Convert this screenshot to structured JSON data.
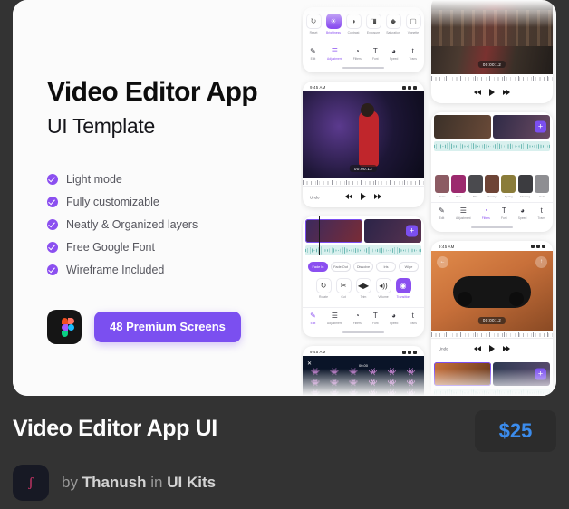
{
  "card": {
    "promo": {
      "title": "Video Editor App",
      "subtitle": "UI Template",
      "features": [
        {
          "label": "Light mode",
          "icon": "check-circle-icon"
        },
        {
          "label": "Fully customizable",
          "icon": "check-circle-icon"
        },
        {
          "label": "Neatly & Organized layers",
          "icon": "check-circle-icon"
        },
        {
          "label": "Free Google Font",
          "icon": "check-circle-icon"
        },
        {
          "label": "Wireframe Included",
          "icon": "check-circle-icon"
        }
      ],
      "figma_icon": "figma-logo-icon",
      "cta_label": "48 Premium Screens",
      "accent_color": "#7b4ff0"
    },
    "gallery": {
      "status_time": "9:45 AM",
      "phones": [
        {
          "id": "editor-adjustment",
          "timecode": "",
          "chips": [],
          "tools": [
            {
              "label": "Reset",
              "glyph": "↻",
              "active": false
            },
            {
              "label": "Brightness",
              "glyph": "☀",
              "active": true
            },
            {
              "label": "Contrast",
              "glyph": "◑",
              "active": false
            },
            {
              "label": "Exposure",
              "glyph": "◨",
              "active": false
            },
            {
              "label": "Saturation",
              "glyph": "◆",
              "active": false
            },
            {
              "label": "Vignette",
              "glyph": "▢",
              "active": false
            }
          ],
          "tabs": [
            {
              "label": "Edit",
              "glyph": "✎",
              "active": false
            },
            {
              "label": "Adjustment",
              "glyph": "☰",
              "active": true
            },
            {
              "label": "Filters",
              "glyph": "◔",
              "active": false
            },
            {
              "label": "Font",
              "glyph": "T",
              "active": false
            },
            {
              "label": "Speed",
              "glyph": "◕",
              "active": false
            },
            {
              "label": "Trans",
              "glyph": "t",
              "active": false
            }
          ]
        },
        {
          "id": "player-red-dress",
          "timecode": "00:00:12",
          "undo_label": "Undo"
        },
        {
          "id": "transitions-panel",
          "chips": [
            {
              "label": "Fade In",
              "active": true
            },
            {
              "label": "Fade Out",
              "active": false
            },
            {
              "label": "Dissolve",
              "active": false
            },
            {
              "label": "Iris",
              "active": false
            },
            {
              "label": "Wipe",
              "active": false
            }
          ],
          "tools": [
            {
              "label": "Rotate",
              "glyph": "↻",
              "active": false
            },
            {
              "label": "Cut",
              "glyph": "✂",
              "active": false
            },
            {
              "label": "Trim",
              "glyph": "◀▶",
              "active": false
            },
            {
              "label": "Volume",
              "glyph": "◂))",
              "active": false
            },
            {
              "label": "Transition",
              "glyph": "◉",
              "active": true
            }
          ],
          "tabs": [
            {
              "label": "Edit",
              "glyph": "✎",
              "active": true
            },
            {
              "label": "Adjustment",
              "glyph": "☰",
              "active": false
            },
            {
              "label": "Filters",
              "glyph": "◔",
              "active": false
            },
            {
              "label": "Font",
              "glyph": "T",
              "active": false
            },
            {
              "label": "Speed",
              "glyph": "◕",
              "active": false
            },
            {
              "label": "Trans",
              "glyph": "t",
              "active": false
            }
          ]
        },
        {
          "id": "space-invaders-game",
          "score": "00.00",
          "close_icon": "close-icon"
        },
        {
          "id": "player-train",
          "timecode": "00:00:12"
        },
        {
          "id": "filters-panel",
          "filters": [
            {
              "label": "Retro",
              "color": "#8c5b63"
            },
            {
              "label": "Pure",
              "color": "#9c2a6e"
            },
            {
              "label": "Mist",
              "color": "#4a4a4e"
            },
            {
              "label": "Smoky",
              "color": "#6e4436"
            },
            {
              "label": "Spring",
              "color": "#8a7c3a"
            },
            {
              "label": "Morning",
              "color": "#3c3c40"
            },
            {
              "label": "Hola",
              "color": "#8e8e92"
            }
          ],
          "tabs": [
            {
              "label": "Edit",
              "glyph": "✎",
              "active": false
            },
            {
              "label": "Adjustment",
              "glyph": "☰",
              "active": false
            },
            {
              "label": "Filters",
              "glyph": "◔",
              "active": true
            },
            {
              "label": "Font",
              "glyph": "T",
              "active": false
            },
            {
              "label": "Speed",
              "glyph": "◕",
              "active": false
            },
            {
              "label": "Trans",
              "glyph": "t",
              "active": false
            }
          ]
        },
        {
          "id": "player-gamepad",
          "timecode": "00:00:12",
          "undo_label": "Undo",
          "back_icon": "back-arrow-icon",
          "export_icon": "export-icon"
        }
      ]
    }
  },
  "footer": {
    "product_name": "Video Editor App UI",
    "price": "$25",
    "price_color": "#3b8ced",
    "avatar_glyph": "ʃ",
    "by_prefix": "by",
    "author": "Thanush",
    "in_word": "in",
    "category": "UI Kits"
  }
}
